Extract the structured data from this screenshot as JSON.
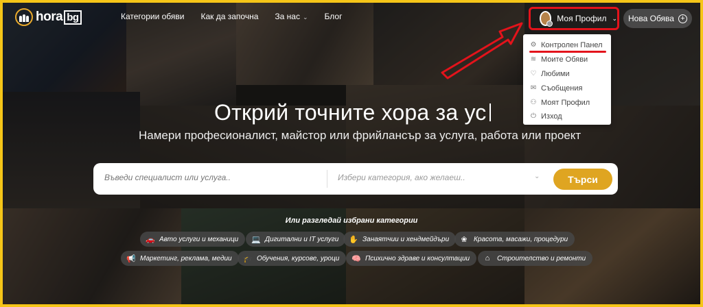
{
  "header": {
    "logo_text": "hora",
    "logo_suffix": "bg",
    "nav": [
      {
        "label": "Категории обяви"
      },
      {
        "label": "Как да започна"
      },
      {
        "label": "За нас"
      },
      {
        "label": "Блог"
      }
    ],
    "profile_label": "Моя Профил",
    "new_ad_label": "Нова Обява"
  },
  "dropdown": {
    "items": [
      {
        "label": "Контролен Панел",
        "icon": "gear-icon"
      },
      {
        "label": "Моите Обяви",
        "icon": "layers-icon"
      },
      {
        "label": "Любими",
        "icon": "heart-icon"
      },
      {
        "label": "Съобщения",
        "icon": "envelope-icon"
      },
      {
        "label": "Моят Профил",
        "icon": "user-icon"
      },
      {
        "label": "Изход",
        "icon": "power-icon"
      }
    ]
  },
  "hero": {
    "title": "Открий точните хора за ус",
    "subtitle": "Намери професионалист, майстор или фрийлансър за услуга, работа или проект"
  },
  "search": {
    "placeholder": "Въведи специалист или услуга..",
    "category_placeholder": "Избери категория, ако желаеш..",
    "button_label": "Търси"
  },
  "categories": {
    "heading": "Или разгледай избрани категории",
    "chips": [
      {
        "label": "Авто услуги и механици",
        "icon": "car-icon"
      },
      {
        "label": "Дигитални и IT услуги",
        "icon": "laptop-icon"
      },
      {
        "label": "Занаятчии и хендмейдъри",
        "icon": "hands-icon"
      },
      {
        "label": "Красота, масажи, процедури",
        "icon": "lotus-icon"
      },
      {
        "label": "Маркетинг, реклама, медии",
        "icon": "megaphone-icon"
      },
      {
        "label": "Обучения, курсове, уроци",
        "icon": "graduation-cap-icon"
      },
      {
        "label": "Психично здраве и консултации",
        "icon": "brain-icon"
      },
      {
        "label": "Строителство и ремонти",
        "icon": "house-tools-icon"
      }
    ]
  },
  "colors": {
    "accent": "#dfa521",
    "highlight": "#e3131b",
    "frame": "#f5c518"
  }
}
